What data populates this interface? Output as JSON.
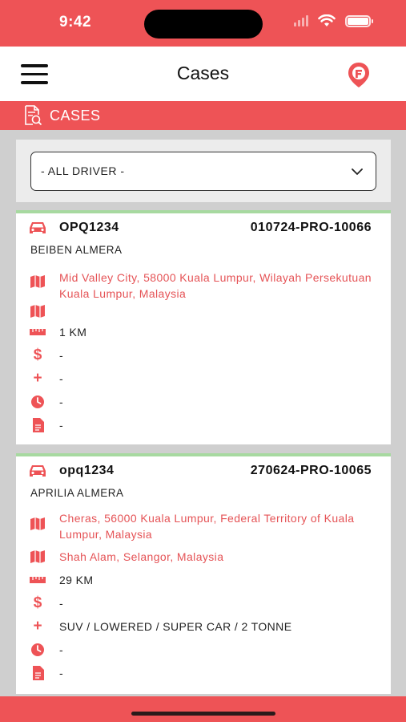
{
  "status_bar": {
    "time": "9:42"
  },
  "header": {
    "title": "Cases"
  },
  "section": {
    "title": "CASES"
  },
  "filter": {
    "selected": "- ALL DRIVER -"
  },
  "cases": [
    {
      "plate": "OPQ1234",
      "ref": "010724-PRO-10066",
      "vehicle": "BEIBEN ALMERA",
      "pickup": "Mid Valley City, 58000 Kuala Lumpur, Wilayah Persekutuan Kuala Lumpur, Malaysia",
      "dropoff": "",
      "distance": "1 KM",
      "price": "-",
      "extras": "-",
      "time": "-",
      "notes": "-"
    },
    {
      "plate": "opq1234",
      "ref": "270624-PRO-10065",
      "vehicle": "APRILIA ALMERA",
      "pickup": "Cheras, 56000 Kuala Lumpur, Federal Territory of Kuala Lumpur, Malaysia",
      "dropoff": "Shah Alam, Selangor, Malaysia",
      "distance": "29 KM",
      "price": "-",
      "extras": "SUV / LOWERED / SUPER CAR / 2 TONNE",
      "time": "-",
      "notes": "-"
    }
  ],
  "icons": {
    "car": "car-icon",
    "map": "map-icon",
    "ruler": "ruler-icon",
    "dollar": "dollar-icon",
    "plus": "plus-icon",
    "clock": "clock-icon",
    "document": "document-icon"
  },
  "colors": {
    "accent": "#ee5356",
    "card_border": "#a7d9a0",
    "background": "#cfcfcf"
  }
}
